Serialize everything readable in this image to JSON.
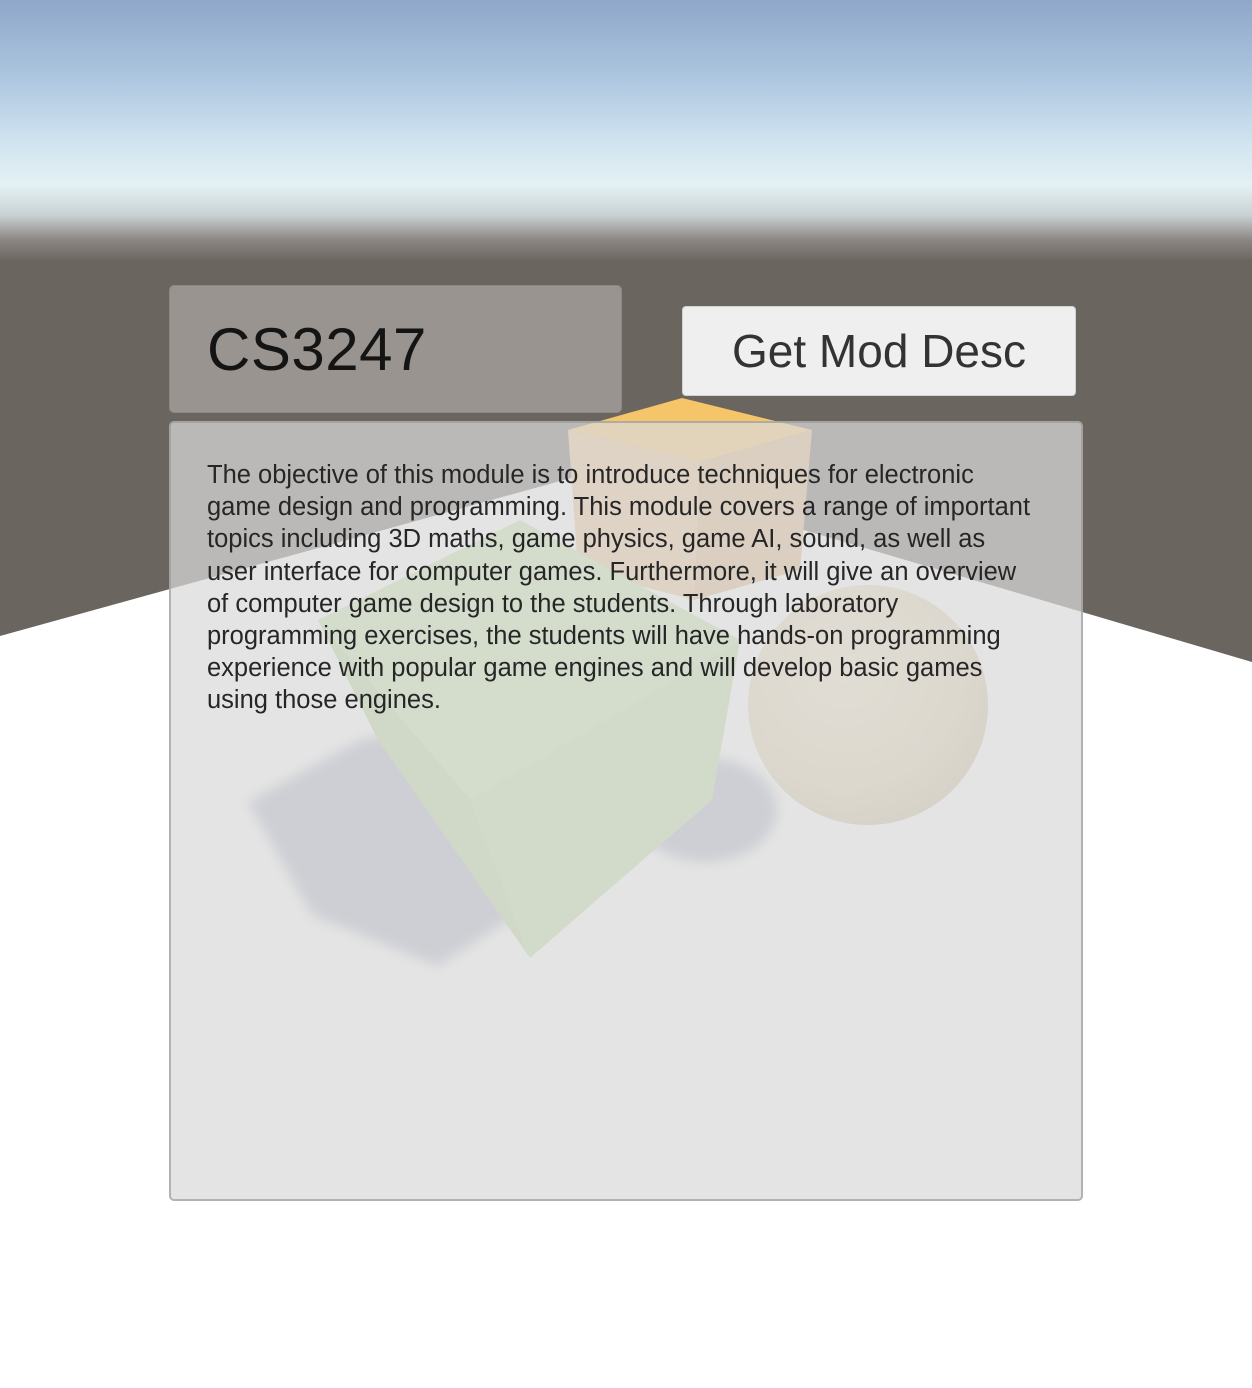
{
  "module_input": {
    "value": "CS3247"
  },
  "get_button": {
    "label": "Get Mod Desc"
  },
  "description": {
    "text": "The objective of this module is to introduce techniques for electronic game design and programming. This module covers a range of important topics including 3D maths, game physics, game AI, sound, as well as user interface for computer games. Furthermore, it will give an overview of computer game design to the students. Through laboratory programming exercises, the students will have hands-on programming experience with popular game engines and will develop basic games using those engines."
  },
  "scene": {
    "objects": [
      "green-cube",
      "orange-cube",
      "beige-sphere"
    ],
    "colors": {
      "green_cube": "#bfe0a0",
      "orange_cube": "#f2c27a",
      "sphere": "#e6d9bd",
      "floor": "#ffffff",
      "ground": "#6b6560",
      "sky_top": "#8fa7c9"
    }
  }
}
